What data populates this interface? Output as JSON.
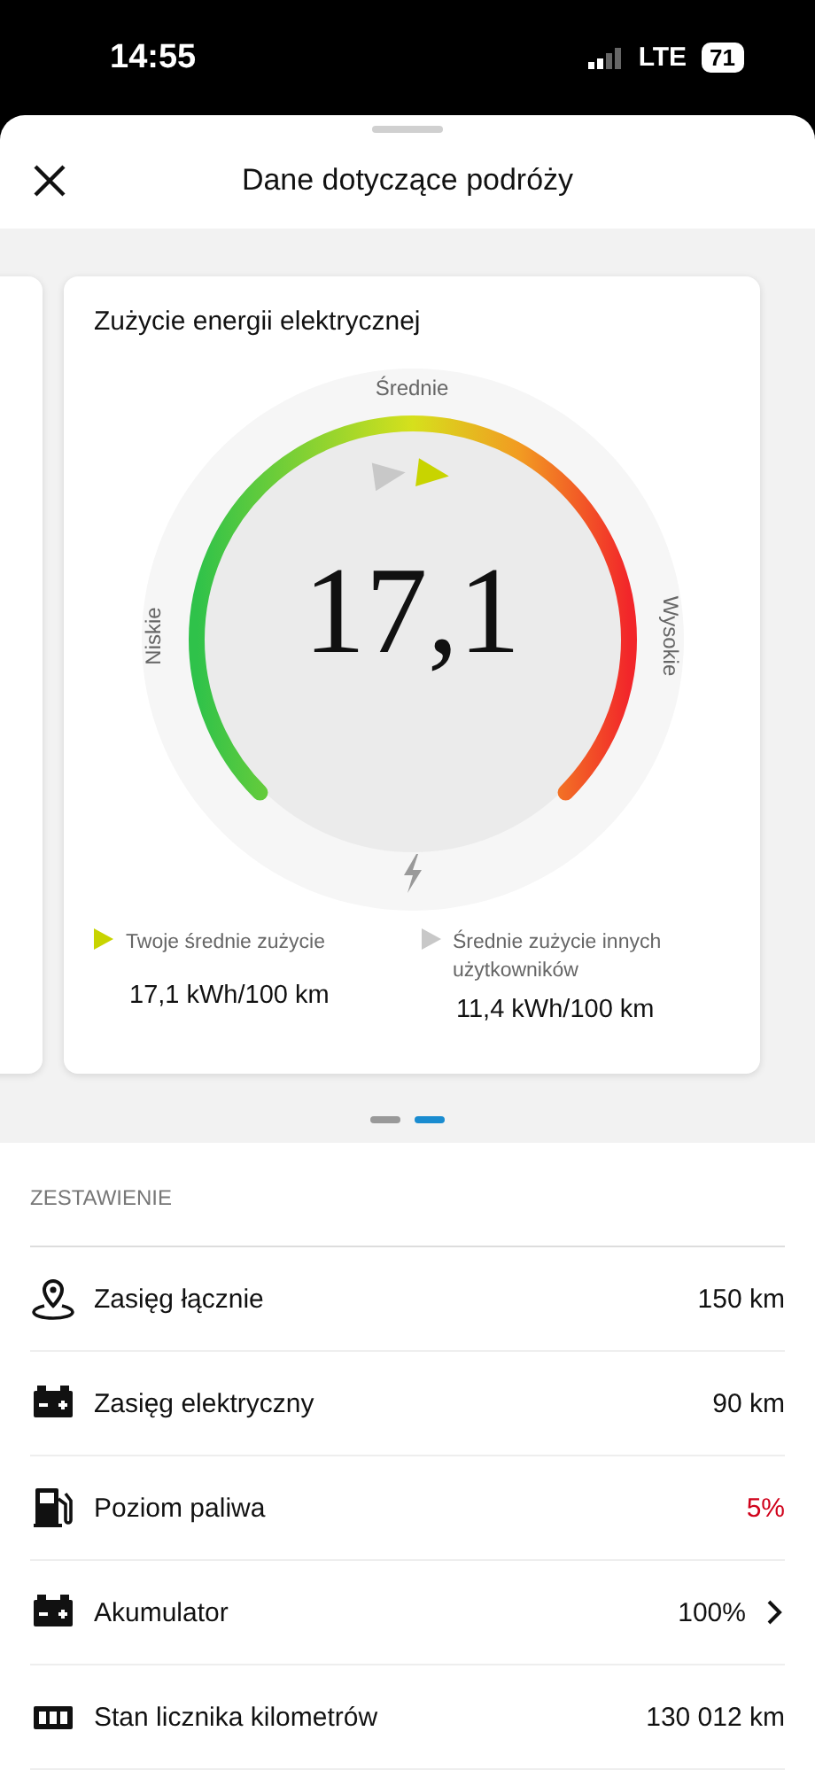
{
  "status_bar": {
    "time": "14:55",
    "network": "LTE",
    "battery": "71"
  },
  "header": {
    "title": "Dane dotyczące podróży"
  },
  "card": {
    "title": "Zużycie energii elektrycznej",
    "gauge": {
      "value": "17,1",
      "label_low": "Niskie",
      "label_mid": "Średnie",
      "label_high": "Wysokie",
      "markers": [
        {
          "kind": "others",
          "color": "#c8c8c8"
        },
        {
          "kind": "yours",
          "color": "#c8d400"
        }
      ]
    },
    "legend": [
      {
        "label": "Twoje średnie zużycie",
        "value": "17,1 kWh/100 km",
        "color": "#c8d400"
      },
      {
        "label": "Średnie zużycie innych użytkowników",
        "value": "11,4 kWh/100 km",
        "color": "#c8c8c8"
      }
    ]
  },
  "pager": [
    {
      "selected": false
    },
    {
      "selected": true
    }
  ],
  "summary": {
    "heading": "ZESTAWIENIE",
    "rows": [
      {
        "kind": "pin",
        "label": "Zasięg łącznie",
        "value": "150 km",
        "alert": false,
        "chevron": false
      },
      {
        "kind": "battery",
        "label": "Zasięg elektryczny",
        "value": "90 km",
        "alert": false,
        "chevron": false
      },
      {
        "kind": "fuel",
        "label": "Poziom paliwa",
        "value": "5%",
        "alert": true,
        "chevron": false
      },
      {
        "kind": "battery",
        "label": "Akumulator",
        "value": "100%",
        "alert": false,
        "chevron": true
      },
      {
        "kind": "odometer",
        "label": "Stan licznika kilometrów",
        "value": "130 012 km",
        "alert": false,
        "chevron": false
      }
    ]
  }
}
